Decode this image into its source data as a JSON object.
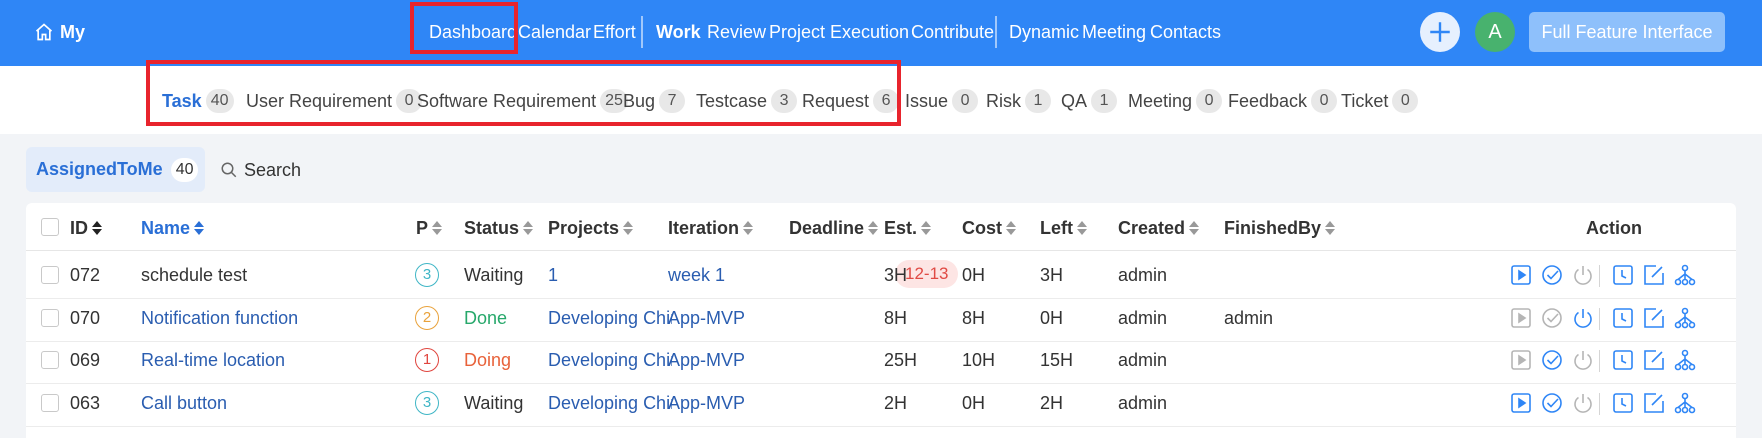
{
  "topnav": {
    "brand": "My",
    "links": [
      {
        "label": "Dashboard",
        "active": false
      },
      {
        "label": "Calendar",
        "active": false
      },
      {
        "label": "Effort",
        "active": false
      },
      {
        "label": "Work",
        "active": true
      },
      {
        "label": "Review",
        "active": false
      },
      {
        "label": "Project",
        "active": false
      },
      {
        "label": "Execution",
        "active": false
      },
      {
        "label": "Contribute",
        "active": false
      },
      {
        "label": "Dynamic",
        "active": false
      },
      {
        "label": "Meeting",
        "active": false
      },
      {
        "label": "Contacts",
        "active": false
      }
    ],
    "plus_icon": "plus-icon",
    "avatar_letter": "A",
    "full_feature_label": "Full Feature Interface"
  },
  "subnav": {
    "tabs": [
      {
        "label": "Task",
        "count": "40",
        "active": true
      },
      {
        "label": "User Requirement",
        "count": "0"
      },
      {
        "label": "Software Requirement",
        "count": "25"
      },
      {
        "label": "Bug",
        "count": "7"
      },
      {
        "label": "Testcase",
        "count": "3"
      },
      {
        "label": "Request",
        "count": "6"
      },
      {
        "label": "Issue",
        "count": "0"
      },
      {
        "label": "Risk",
        "count": "1"
      },
      {
        "label": "QA",
        "count": "1"
      },
      {
        "label": "Meeting",
        "count": "0"
      },
      {
        "label": "Feedback",
        "count": "0"
      },
      {
        "label": "Ticket",
        "count": "0"
      }
    ]
  },
  "filter": {
    "assigned_label": "AssignedToMe",
    "assigned_count": "40",
    "search_label": "Search"
  },
  "table": {
    "columns": [
      "ID",
      "Name",
      "P",
      "Status",
      "Projects",
      "Iteration",
      "Deadline",
      "Est.",
      "Cost",
      "Left",
      "Created",
      "FinishedBy",
      "Action"
    ],
    "rows": [
      {
        "id": "072",
        "name": "schedule test",
        "priority": "3",
        "status": "Waiting",
        "project": "1",
        "iteration": "week 1",
        "deadline": "12-13",
        "est": "3H",
        "cost": "0H",
        "left": "3H",
        "created": "admin",
        "finished_by": ""
      },
      {
        "id": "070",
        "name": "Notification function",
        "priority": "2",
        "status": "Done",
        "project": "Developing Chir",
        "iteration": "App-MVP",
        "deadline": "",
        "est": "8H",
        "cost": "8H",
        "left": "0H",
        "created": "admin",
        "finished_by": "admin"
      },
      {
        "id": "069",
        "name": "Real-time location",
        "priority": "1",
        "status": "Doing",
        "project": "Developing Chir",
        "iteration": "App-MVP",
        "deadline": "",
        "est": "25H",
        "cost": "10H",
        "left": "15H",
        "created": "admin",
        "finished_by": ""
      },
      {
        "id": "063",
        "name": "Call button",
        "priority": "3",
        "status": "Waiting",
        "project": "Developing Chir",
        "iteration": "App-MVP",
        "deadline": "",
        "est": "2H",
        "cost": "0H",
        "left": "2H",
        "created": "admin",
        "finished_by": ""
      }
    ],
    "action_icons": [
      "start-icon",
      "finish-icon",
      "close-icon",
      "record-effort-icon",
      "edit-icon",
      "subtask-icon"
    ]
  },
  "colors": {
    "topbar": "#2f86f6",
    "accent_blue": "#2a6fd6",
    "highlight_red": "#e8242d",
    "status_done": "#27a86b",
    "status_doing": "#e8623a",
    "priority_1": "#e0453e",
    "priority_2": "#e9a23b",
    "priority_3": "#3fb6c6",
    "action_blue": "#2f86f6",
    "action_disabled": "#b5b5b5"
  }
}
